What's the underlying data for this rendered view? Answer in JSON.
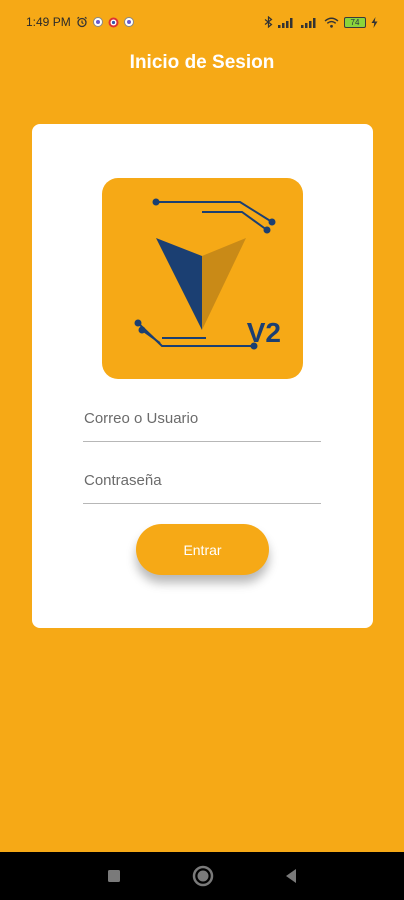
{
  "status_bar": {
    "time": "1:49 PM",
    "battery_level": "74",
    "left_icons": [
      "alarm-icon",
      "notification-dot-icon",
      "notification-app-icon",
      "notification-dot-icon"
    ],
    "right_icons": [
      "bluetooth-icon",
      "signal-icon",
      "signal-icon",
      "wifi-icon",
      "battery-icon",
      "charging-icon"
    ]
  },
  "header": {
    "title": "Inicio de Sesion"
  },
  "logo": {
    "version": "V2"
  },
  "form": {
    "user_placeholder": "Correo o Usuario",
    "password_placeholder": "Contraseña",
    "submit_label": "Entrar"
  },
  "nav_bar": {
    "buttons": [
      "recents-icon",
      "home-icon",
      "back-icon"
    ]
  },
  "colors": {
    "background": "#F6A916",
    "card": "#FFFFFF",
    "logo_blue": "#1B3F72"
  }
}
